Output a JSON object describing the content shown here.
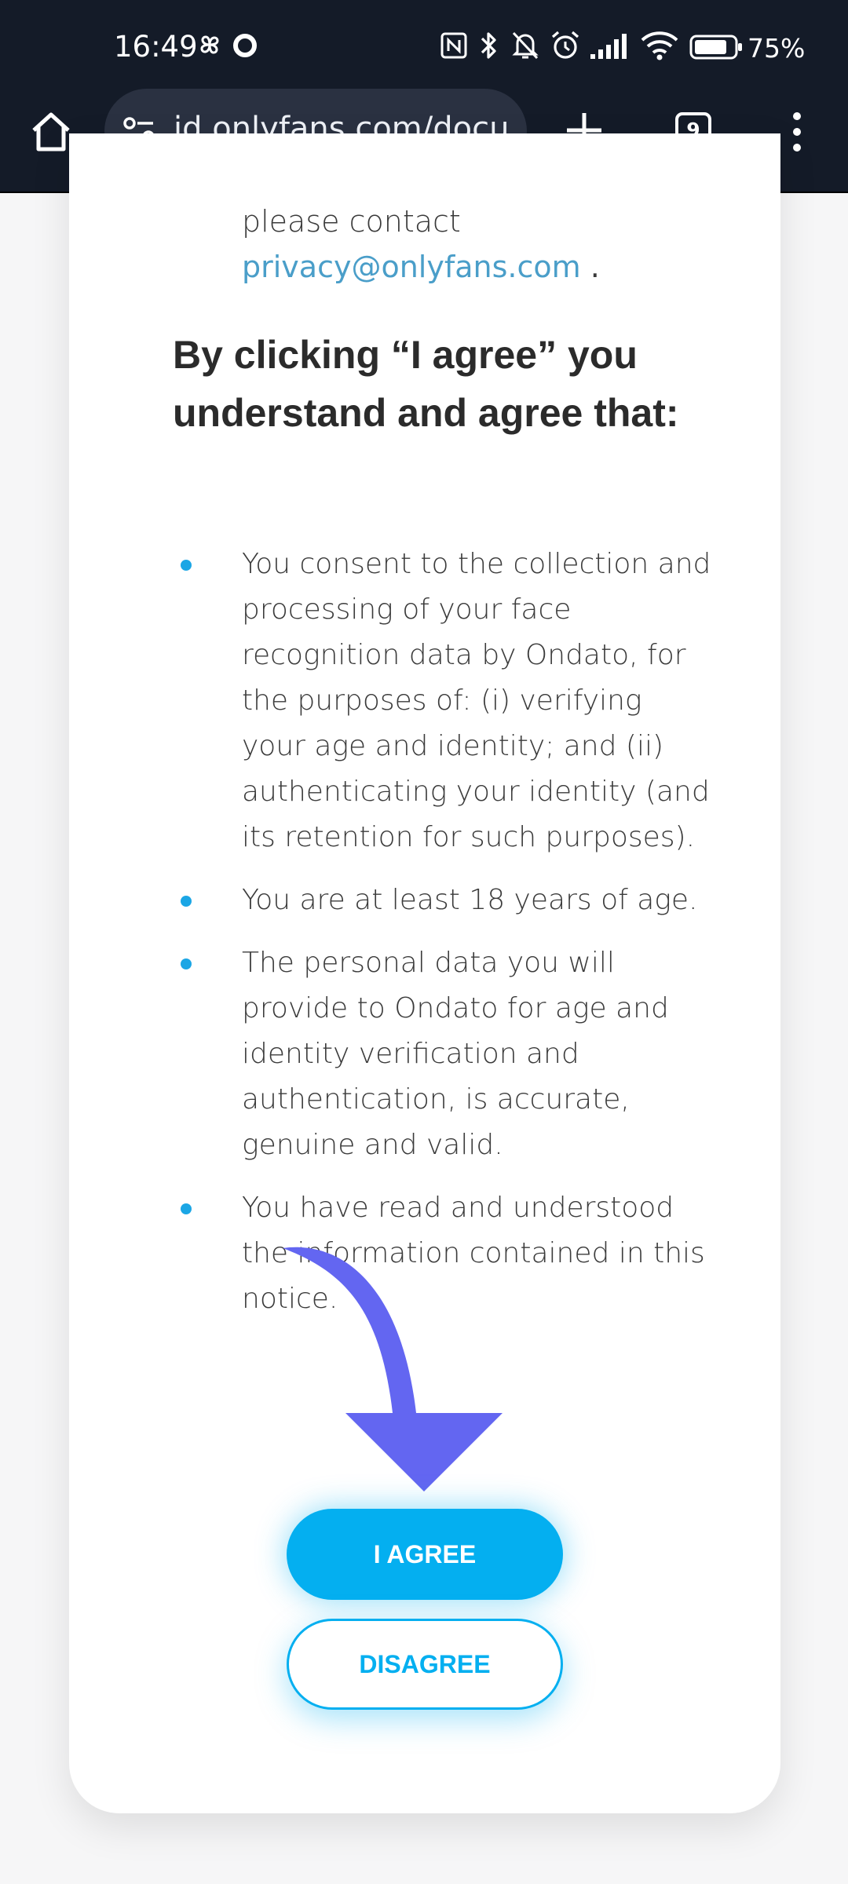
{
  "status_bar": {
    "time": "16:49",
    "battery": "75%",
    "icons": [
      "pinwheel-icon",
      "circle-icon",
      "nfc-icon",
      "bluetooth-icon",
      "bell-off-icon",
      "alarm-icon",
      "signal-icon",
      "wifi-icon",
      "battery-icon"
    ]
  },
  "browser": {
    "url": "id.onlyfans.com/docu",
    "tab_count": "9",
    "icons": [
      "home-icon",
      "site-settings-icon",
      "new-tab-icon",
      "tab-switcher-icon",
      "overflow-menu-icon"
    ]
  },
  "content": {
    "contact_text": "please contact",
    "contact_email": "privacy@onlyfans.com",
    "contact_suffix": " .",
    "heading": "By clicking “I agree” you understand and agree that:",
    "bullets": [
      "You consent to the collection and processing of your face recognition data by Ondato, for the purposes of: (i) verifying your age and identity; and (ii) authenticating your identity (and its retention for such purposes).",
      "You are at least 18 years of age.",
      "The personal data you will provide to Ondato for age and identity verification and authentication, is accurate, genuine and valid.",
      "You have read and understood the information contained in this notice."
    ]
  },
  "buttons": {
    "agree": "I AGREE",
    "disagree": "DISAGREE"
  },
  "colors": {
    "accent": "#04aff0",
    "link": "#4a9ec9",
    "arrow": "#6366f1",
    "status_bar": "#141b28"
  }
}
